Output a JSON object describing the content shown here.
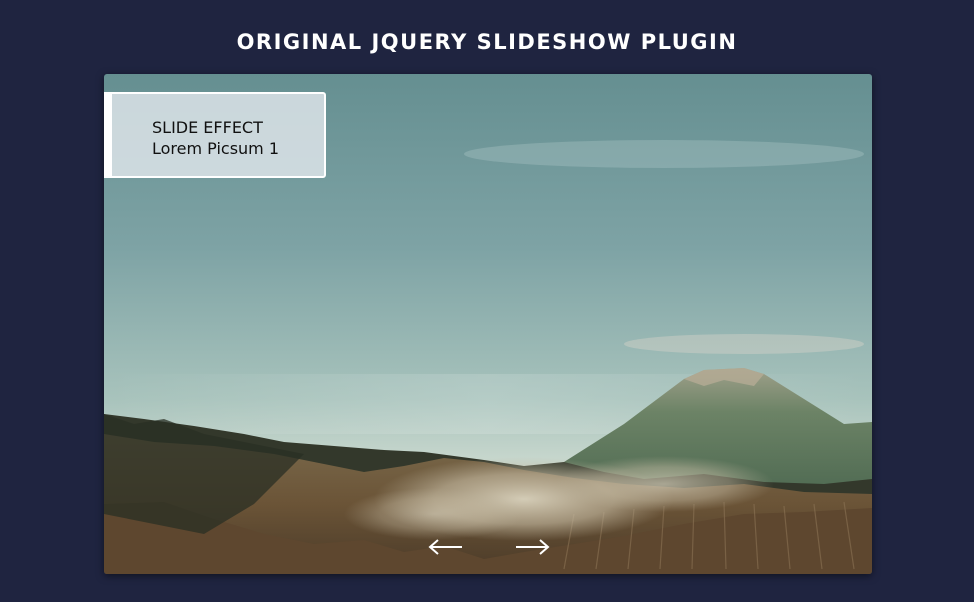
{
  "page": {
    "title": "ORIGINAL JQUERY SLIDESHOW PLUGIN"
  },
  "slideshow": {
    "current_slide": 1,
    "caption": {
      "effect": "SLIDE EFFECT",
      "name": "Lorem Picsum 1"
    },
    "controls": {
      "prev_icon": "arrow-left-icon",
      "next_icon": "arrow-right-icon"
    }
  },
  "colors": {
    "page_background": "#1f2440",
    "title_text": "#ffffff",
    "caption_background": "#e0e6ec",
    "caption_text": "#111111",
    "arrow_color": "#ffffff"
  }
}
